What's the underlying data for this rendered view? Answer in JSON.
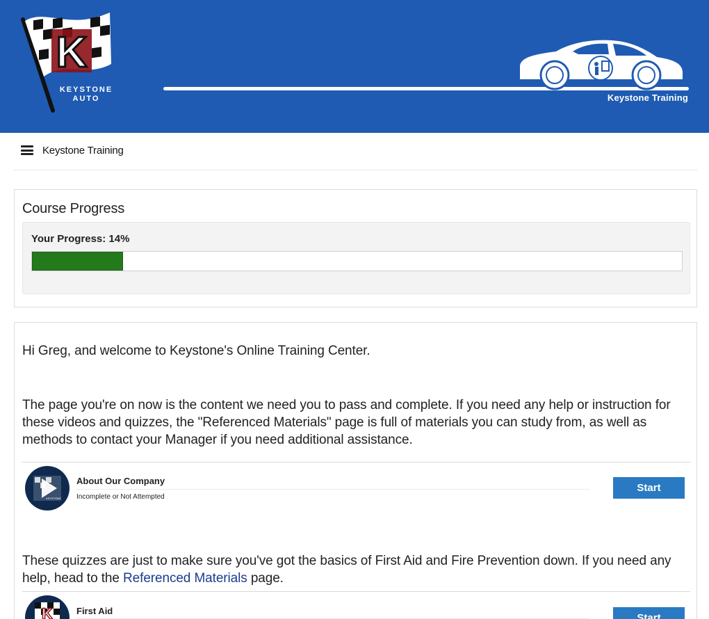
{
  "brand": {
    "logo_line1": "KEYSTONE",
    "logo_line2": "AUTO",
    "logo_letter": "K",
    "banner_title": "Keystone Training",
    "colors": {
      "banner": "#1f5bb2",
      "progress": "#237a1b",
      "button": "#2a7ac3",
      "link": "#1a3d8f"
    }
  },
  "nav": {
    "menu_icon": "hamburger-menu-icon",
    "title": "Keystone Training"
  },
  "progress": {
    "heading": "Course Progress",
    "label": "Your Progress: 14%",
    "percent": 14
  },
  "content": {
    "greeting": "Hi Greg, and welcome to Keystone's Online Training Center.",
    "intro": "The page you're on now is the content we need you to pass and complete. If you need any help or instruction for these videos and quizzes, the \"Referenced Materials\" page is full of materials you can study from, as well as methods to contact your Manager if you need additional assistance.",
    "quiz_intro_before": "These quizzes are just to make sure you've got the basics of First Aid and Fire Prevention down. If you need any help, head to the ",
    "quiz_intro_link": "Referenced Materials",
    "quiz_intro_after": " page.",
    "lessons": [
      {
        "title": "About Our Company",
        "status": "Incomplete or Not Attempted",
        "button": "Start",
        "icon": "play-icon"
      },
      {
        "title": "First Aid",
        "status": "",
        "button": "Start",
        "icon": "keystone-logo-icon"
      }
    ]
  }
}
